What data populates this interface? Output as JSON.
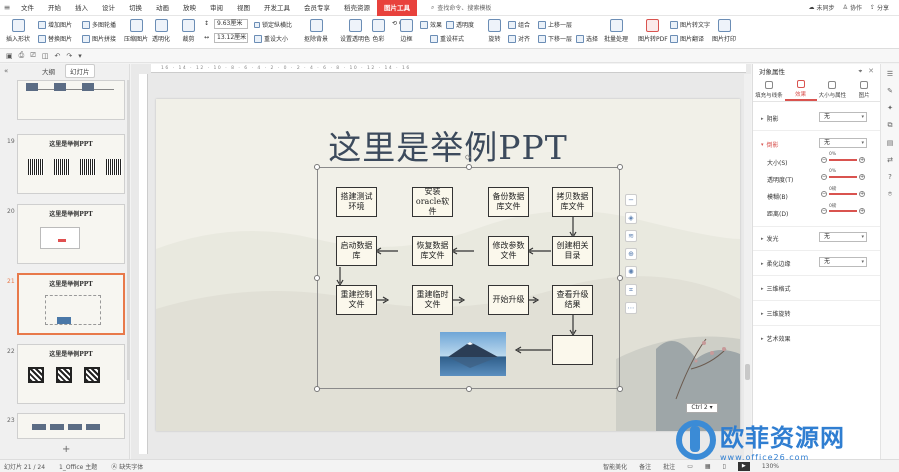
{
  "menubar": {
    "file": "文件",
    "items": [
      "开始",
      "插入",
      "设计",
      "切换",
      "动画",
      "放映",
      "审阅",
      "视图",
      "开发工具",
      "会员专享",
      "稻壳资源"
    ],
    "active_tab": "图片工具",
    "search_placeholder": "查找命令、搜索模板",
    "unsynced": "未同步",
    "collab": "协作",
    "share": "分享"
  },
  "ribbon": {
    "insert_shape": "插入形状",
    "add_image": "增加图片",
    "multi_compose": "多图轮播",
    "replace_image": "替换图片",
    "image_combine": "图片拼接",
    "compress": "压缩图片",
    "transparent": "透明化",
    "crop": "裁剪",
    "height": "9.63厘米",
    "width": "13.12厘米",
    "lock_ratio": "锁定纵横比",
    "reset_size": "重设大小",
    "cutout": "抠除背景",
    "set_transparent": "设置透明色",
    "color": "色彩",
    "border": "边框",
    "effect": "效果",
    "transparency": "透明度",
    "reset_style": "重设样式",
    "rotate": "旋转",
    "group": "组合",
    "align": "对齐",
    "bring_forward": "上移一层",
    "send_backward": "下移一层",
    "select": "选择",
    "batch": "批量处理",
    "to_pdf": "图片转PDF",
    "to_text": "图片转文字",
    "translate": "图片翻译",
    "print": "图片打印"
  },
  "leftpanel": {
    "tab_outline": "大纲",
    "tab_slides": "幻灯片",
    "slides": [
      {
        "num": "19",
        "title": "这里是举例PPT"
      },
      {
        "num": "20",
        "title": "这里是举例PPT"
      },
      {
        "num": "21",
        "title": "这里是举例PPT"
      },
      {
        "num": "22",
        "title": "这里是举例PPT"
      },
      {
        "num": "23",
        "title": ""
      }
    ],
    "add": "+"
  },
  "slide": {
    "title": "这里是举例PPT",
    "boxes": [
      "搭建测试环境",
      "安装oracle软件",
      "备份数据库文件",
      "拷贝数据库文件",
      "启动数据库",
      "恢复数据库文件",
      "修改参数文件",
      "创建相关目录",
      "重建控制文件",
      "重建临时文件",
      "开始升级",
      "查看升级结果",
      ""
    ]
  },
  "zoom_tooltip": "Ctrl 2 ▾",
  "rightpanel": {
    "title": "对象属性",
    "tabs": [
      "填充与线条",
      "效果",
      "大小与属性",
      "图片"
    ],
    "shadow": "阴影",
    "shadow_val": "无",
    "reflection": "倒影",
    "reflection_val": "无",
    "size": "大小(S)",
    "transparency": "透明度(T)",
    "blur": "模糊(B)",
    "distance": "距离(D)",
    "glow": "发光",
    "glow_val": "无",
    "soft_edge": "柔化边缘",
    "soft_edge_val": "无",
    "three_d_format": "三维格式",
    "three_d_rotate": "三维旋转",
    "artistic": "艺术效果",
    "pct": "0%",
    "pt": "0磅"
  },
  "statusbar": {
    "slide_info": "幻灯片 21 / 24",
    "theme": "1_Office 主题",
    "missing_font": "缺失字体",
    "smart_beautify": "智能美化",
    "notes": "备注",
    "comments": "批注",
    "zoom": "130%"
  },
  "watermark": {
    "text": "欧菲资源网",
    "url": "www.office26.com"
  }
}
